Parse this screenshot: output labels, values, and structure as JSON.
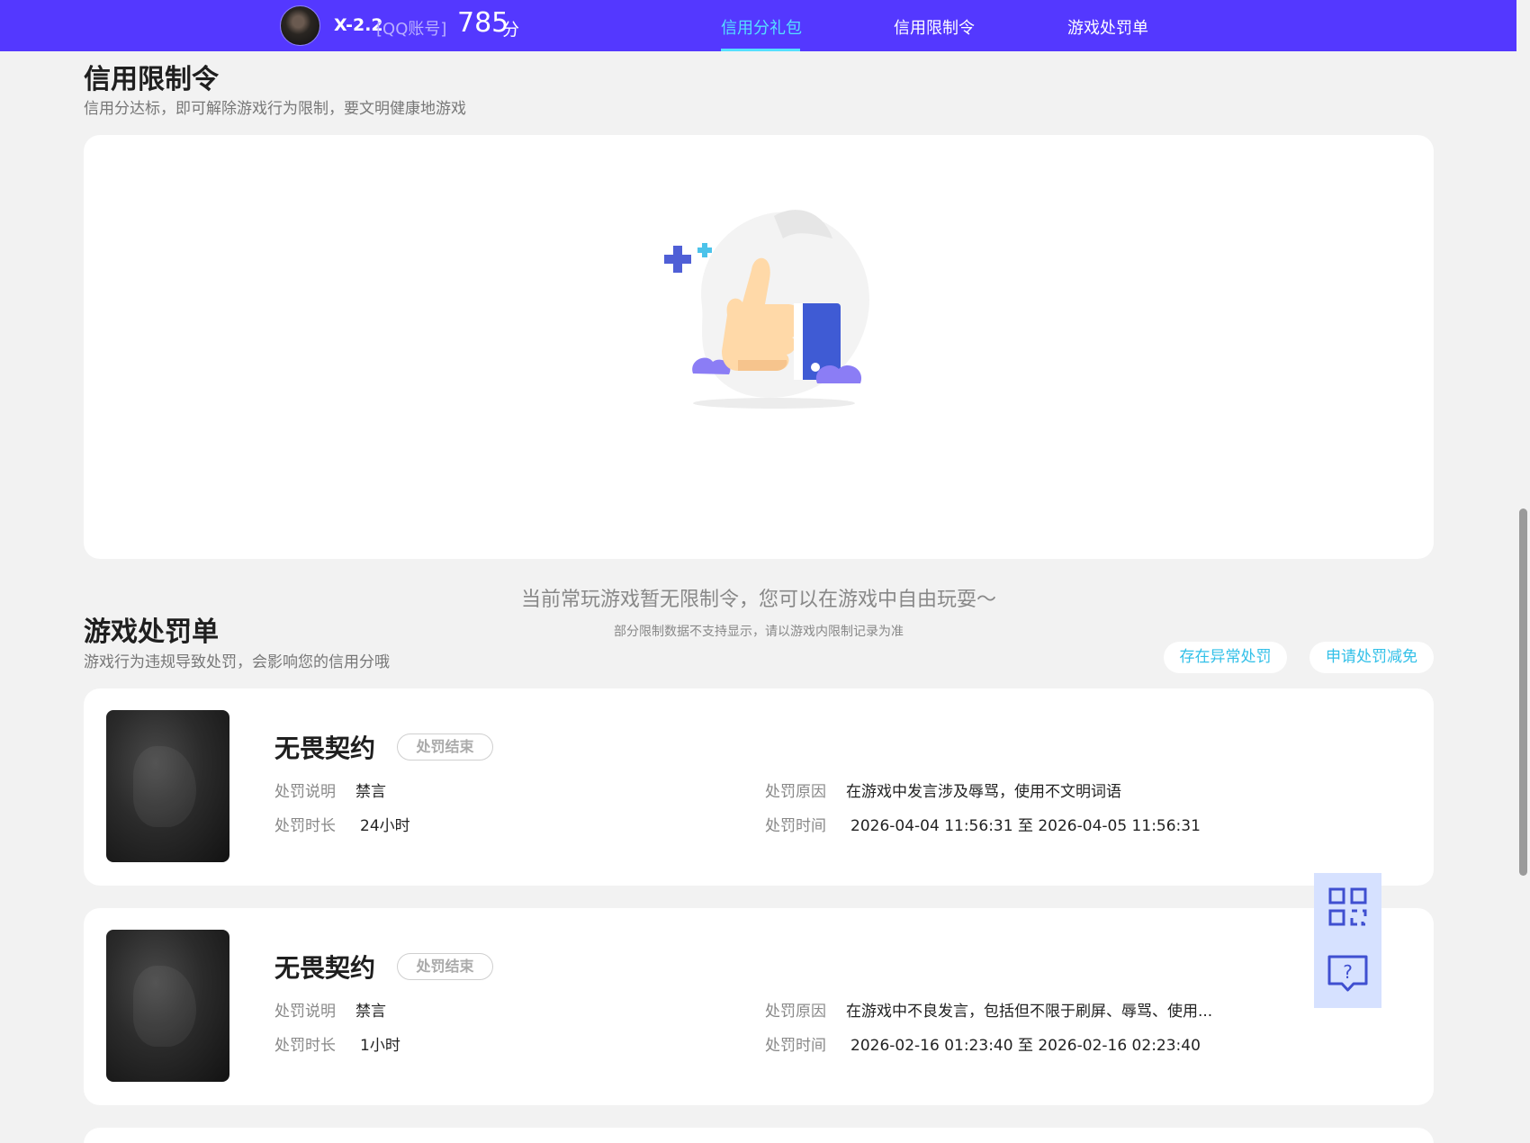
{
  "header": {
    "username": "X-2.2",
    "account_type": "[QQ账号]",
    "score": "785",
    "score_unit": "分",
    "nav": [
      {
        "label": "信用分礼包",
        "active": true
      },
      {
        "label": "信用限制令",
        "active": false
      },
      {
        "label": "游戏处罚单",
        "active": false
      }
    ]
  },
  "restriction": {
    "title": "信用限制令",
    "subtitle": "信用分达标，即可解除游戏行为限制，要文明健康地游戏",
    "empty_main": "当前常玩游戏暂无限制令，您可以在游戏中自由玩耍～",
    "empty_sub": "部分限制数据不支持显示，请以游戏内限制记录为准"
  },
  "penalty": {
    "title": "游戏处罚单",
    "subtitle": "游戏行为违规导致处罚，会影响您的信用分哦",
    "actions": [
      "存在异常处罚",
      "申请处罚减免"
    ],
    "labels": {
      "desc": "处罚说明",
      "duration": "处罚时长",
      "reason": "处罚原因",
      "time": "处罚时间"
    },
    "items": [
      {
        "game": "无畏契约",
        "status": "处罚结束",
        "desc": "禁言",
        "duration": "24小时",
        "reason": "在游戏中发言涉及辱骂，使用不文明词语",
        "time": "2026-04-04 11:56:31 至 2026-04-05 11:56:31"
      },
      {
        "game": "无畏契约",
        "status": "处罚结束",
        "desc": "禁言",
        "duration": "1小时",
        "reason": "在游戏中不良发言，包括但不限于刷屏、辱骂、使用...",
        "time": "2026-02-16 01:23:40 至 2026-02-16 02:23:40"
      }
    ]
  },
  "colors": {
    "header_bg": "#5438ff",
    "accent": "#55e0ff",
    "link": "#33c0e8"
  },
  "icons": {
    "side": [
      "qr-code-icon",
      "help-chat-icon"
    ]
  }
}
